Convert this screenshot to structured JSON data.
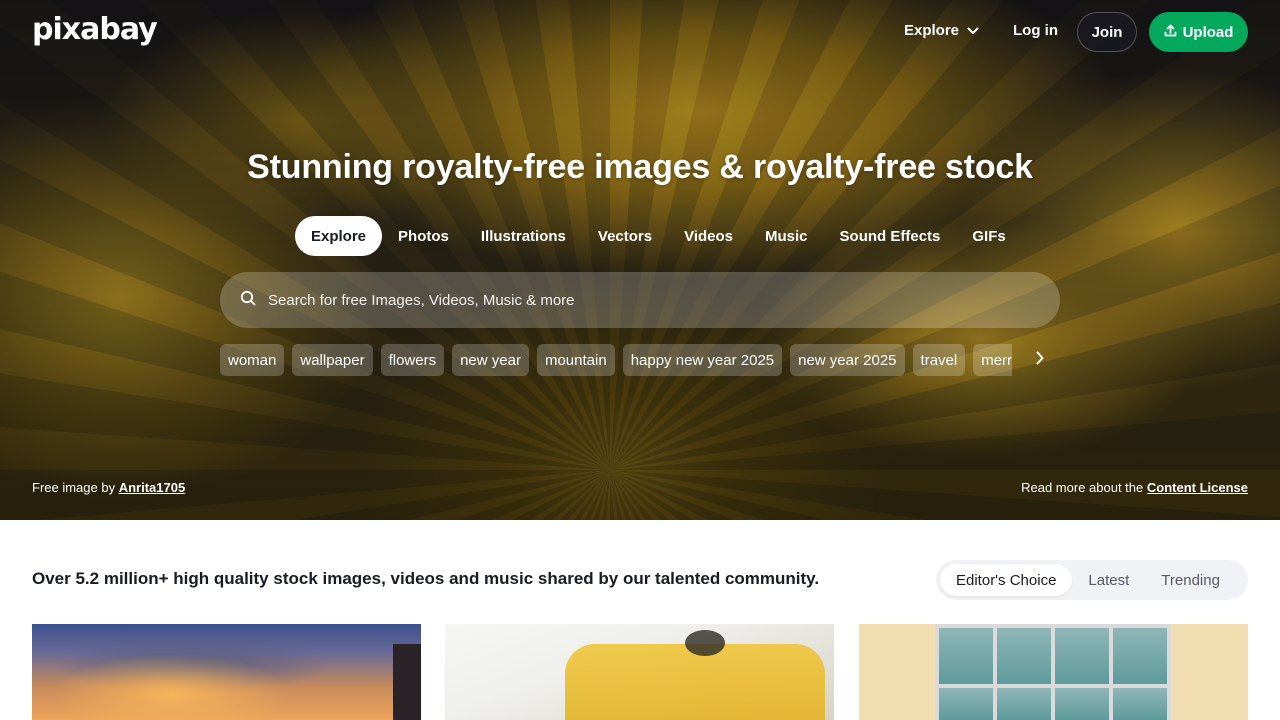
{
  "header": {
    "logo": "pixabay",
    "explore_label": "Explore",
    "login_label": "Log in",
    "join_label": "Join",
    "upload_label": "Upload"
  },
  "hero": {
    "headline": "Stunning royalty-free images & royalty-free stock",
    "tabs": [
      {
        "label": "Explore",
        "active": true
      },
      {
        "label": "Photos"
      },
      {
        "label": "Illustrations"
      },
      {
        "label": "Vectors"
      },
      {
        "label": "Videos"
      },
      {
        "label": "Music"
      },
      {
        "label": "Sound Effects"
      },
      {
        "label": "GIFs"
      }
    ],
    "search_placeholder": "Search for free Images, Videos, Music & more",
    "tags": [
      "woman",
      "wallpaper",
      "flowers",
      "new year",
      "mountain",
      "happy new year 2025",
      "new year 2025",
      "travel",
      "merry christmas"
    ],
    "credit_prefix": "Free image by",
    "credit_author": "Anrita1705",
    "license_prefix": "Read more about the",
    "license_link": "Content License"
  },
  "main": {
    "tagline": "Over 5.2 million+ high quality stock images, videos and music shared by our talented community.",
    "sort_options": [
      {
        "label": "Editor's Choice",
        "active": true
      },
      {
        "label": "Latest"
      },
      {
        "label": "Trending"
      }
    ]
  },
  "colors": {
    "brand_green": "#02a95c",
    "text_dark": "#191b26"
  },
  "icons": [
    "chevron-down-icon",
    "upload-icon",
    "search-icon",
    "chevron-right-icon"
  ]
}
